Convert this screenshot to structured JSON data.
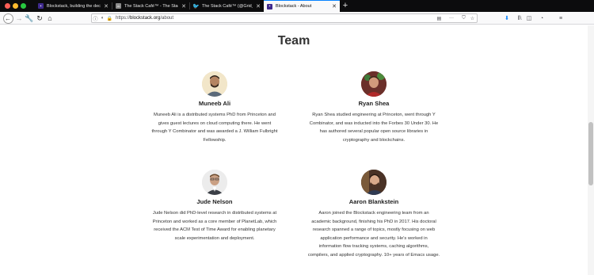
{
  "browser": {
    "tabs": [
      {
        "title": "Blockstack, building the decentr",
        "favicon": "blockstack"
      },
      {
        "title": "The Stack Café™ - The Stack",
        "favicon": "stack-cafe"
      },
      {
        "title": "The Stack Café™ (@Grid_dive",
        "favicon": "twitter"
      },
      {
        "title": "Blockstack - About",
        "favicon": "blockstack",
        "active": true
      }
    ],
    "new_tab": "+",
    "url_scheme": "https://",
    "url_domain": "blockstack.org",
    "url_path": "/about",
    "url_more": "···"
  },
  "page": {
    "heading": "Team",
    "members": [
      {
        "name": "Muneeb Ali",
        "bio_lines": [
          "Muneeb Ali is a distributed systems PhD from Princeton and",
          "gives guest lectures on cloud computing there. He went",
          "through Y Combinator and was awarded a J. William Fulbright",
          "Fellowship."
        ]
      },
      {
        "name": "Ryan Shea",
        "bio_lines": [
          "Ryan Shea studied engineering at Princeton, went through Y",
          "Combinator, and was inducted into the Forbes 30 Under 30. He",
          "has authored several popular open source libraries in",
          "cryptography and blockchains."
        ]
      },
      {
        "name": "Jude Nelson",
        "bio_lines": [
          "Jude Nelson did PhD-level research in distributed systems at",
          "Princeton and worked as a core member of PlanetLab, which",
          "received the ACM Test of Time Award for enabling planetary",
          "scale experimentation and deployment."
        ]
      },
      {
        "name": "Aaron Blankstein",
        "bio_lines": [
          "Aaron joined the Blockstack engineering team from an",
          "academic background, finishing his PhD in 2017. His doctoral",
          "research spanned a range of topics, mostly focusing on web",
          "application performance and security. He's worked in",
          "information flow tracking systems, caching algorithms,",
          "compilers, and applied cryptography. 10+ years of Emacs usage."
        ]
      }
    ]
  }
}
